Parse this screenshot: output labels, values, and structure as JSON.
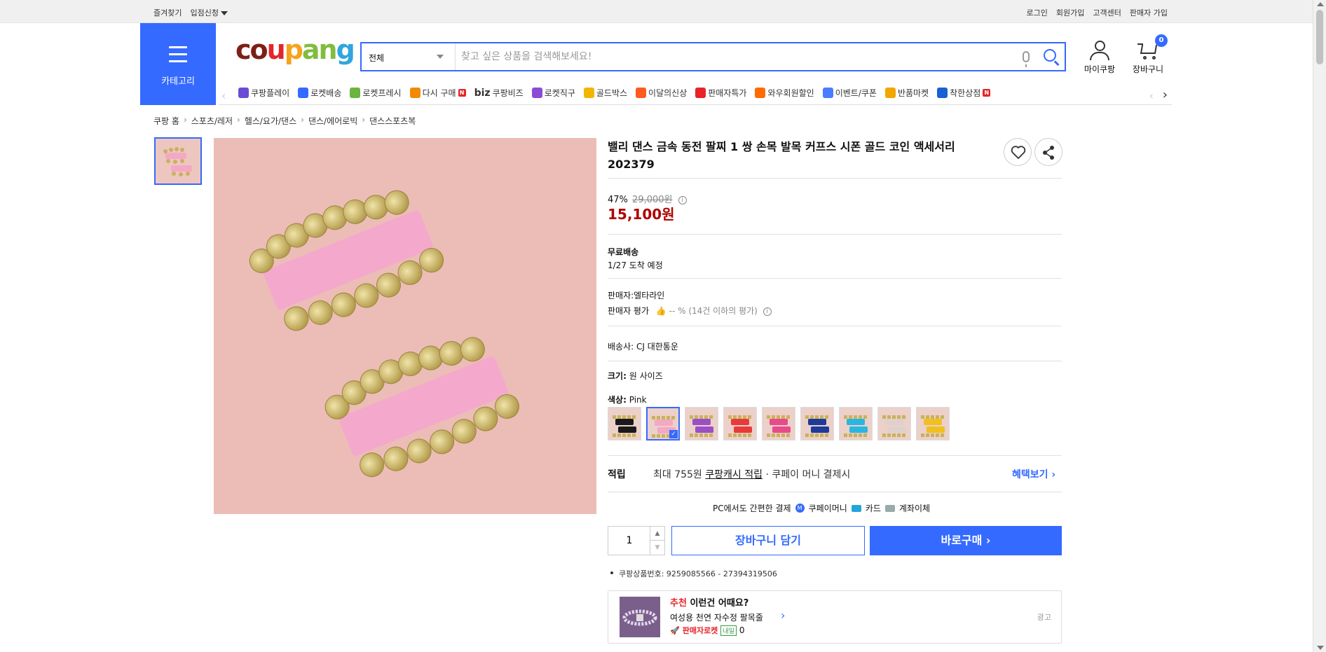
{
  "topbar": {
    "favorites": "즐겨찾기",
    "seller_apply": "입점신청",
    "login": "로그인",
    "signup": "회원가입",
    "customer_center": "고객센터",
    "seller_signup": "판매자 가입"
  },
  "header": {
    "category_label": "카테고리",
    "logo_parts": [
      "co",
      "u",
      "p",
      "an",
      "g"
    ],
    "search_category": "전체",
    "search_placeholder": "찾고 싶은 상품을 검색해보세요!",
    "my_coupang": "마이쿠팡",
    "cart": "장바구니",
    "cart_count": "0"
  },
  "menu": [
    {
      "label": "쿠팡플레이",
      "icon": "play-icon",
      "color": "#6b4bd6"
    },
    {
      "label": "로켓배송",
      "icon": "rocket-icon",
      "color": "#346aff"
    },
    {
      "label": "로켓프레시",
      "icon": "rocket-fresh-icon",
      "color": "#6cb33f"
    },
    {
      "label": "다시 구매",
      "icon": "rebuy-icon",
      "color": "#f08a00",
      "badge": "N"
    },
    {
      "label": "쿠팡비즈",
      "icon": "biz-icon",
      "prefix": "biz",
      "color": "#111"
    },
    {
      "label": "로켓직구",
      "icon": "global-icon",
      "color": "#8c4bd6"
    },
    {
      "label": "골드박스",
      "icon": "goldbox-icon",
      "color": "#f2b600"
    },
    {
      "label": "이달의신상",
      "icon": "new-icon",
      "color": "#ff5a1f"
    },
    {
      "label": "판매자특가",
      "icon": "sale-icon",
      "color": "#e52528"
    },
    {
      "label": "와우회원할인",
      "icon": "wow-icon",
      "color": "#ff6b00"
    },
    {
      "label": "이벤트/쿠폰",
      "icon": "coupon-icon",
      "color": "#4a7cff"
    },
    {
      "label": "반품마켓",
      "icon": "return-market-icon",
      "color": "#f2a600"
    },
    {
      "label": "착한상점",
      "icon": "good-store-icon",
      "color": "#1a5fd4",
      "badge": "N"
    }
  ],
  "breadcrumb": [
    "쿠팡 홈",
    "스포츠/레저",
    "헬스/요가/댄스",
    "댄스/에어로빅",
    "댄스스포츠복"
  ],
  "product": {
    "title": "밸리 댄스 금속 동전 팔찌 1 쌍 손목 발목 커프스 시폰 골드 코인 액세서리 202379",
    "discount_rate": "47%",
    "original_price": "29,000원",
    "price": "15,100원",
    "shipping_label": "무료배송",
    "arrival": "1/27 도착 예정",
    "seller": "판매자:엘타라인",
    "seller_rating_label": "판매자 평가",
    "seller_rating_value": "-- % (14건 이하의 평가)",
    "carrier": "배송사:  CJ 대한통운",
    "size_label": "크기:",
    "size_value": "원 사이즈",
    "color_label": "색상:",
    "color_value": "Pink",
    "colors": [
      "#1a1a1a",
      "#f3a8c4",
      "#9b4fc5",
      "#e83a3a",
      "#e84a8a",
      "#1e3a9a",
      "#2bb6e0",
      "#e0d0cc",
      "#f0c020"
    ],
    "selected_color_index": 1,
    "reward_label": "적립",
    "reward_prefix": "최대 755원 ",
    "reward_link": "쿠팡캐시 적립",
    "reward_suffix": " · 쿠페이 머니 결제시",
    "benefit": "혜택보기 ›",
    "pc_pay": "PC에서도 간편한 결제",
    "pay_methods": [
      "쿠페이머니",
      "카드",
      "계좌이체"
    ],
    "quantity": "1",
    "add_to_cart": "장바구니 담기",
    "buy_now": "바로구매 ›",
    "product_id": "쿠팡상품번호: 9259085566 - 27394319506"
  },
  "recommend": {
    "prefix": "추천",
    "title": " 이런건 어때요?",
    "name": "여성용 천연 자수정 팔목줄",
    "badge": "판매자로켓",
    "tag": "내일",
    "count": "0",
    "ad": "광고"
  }
}
